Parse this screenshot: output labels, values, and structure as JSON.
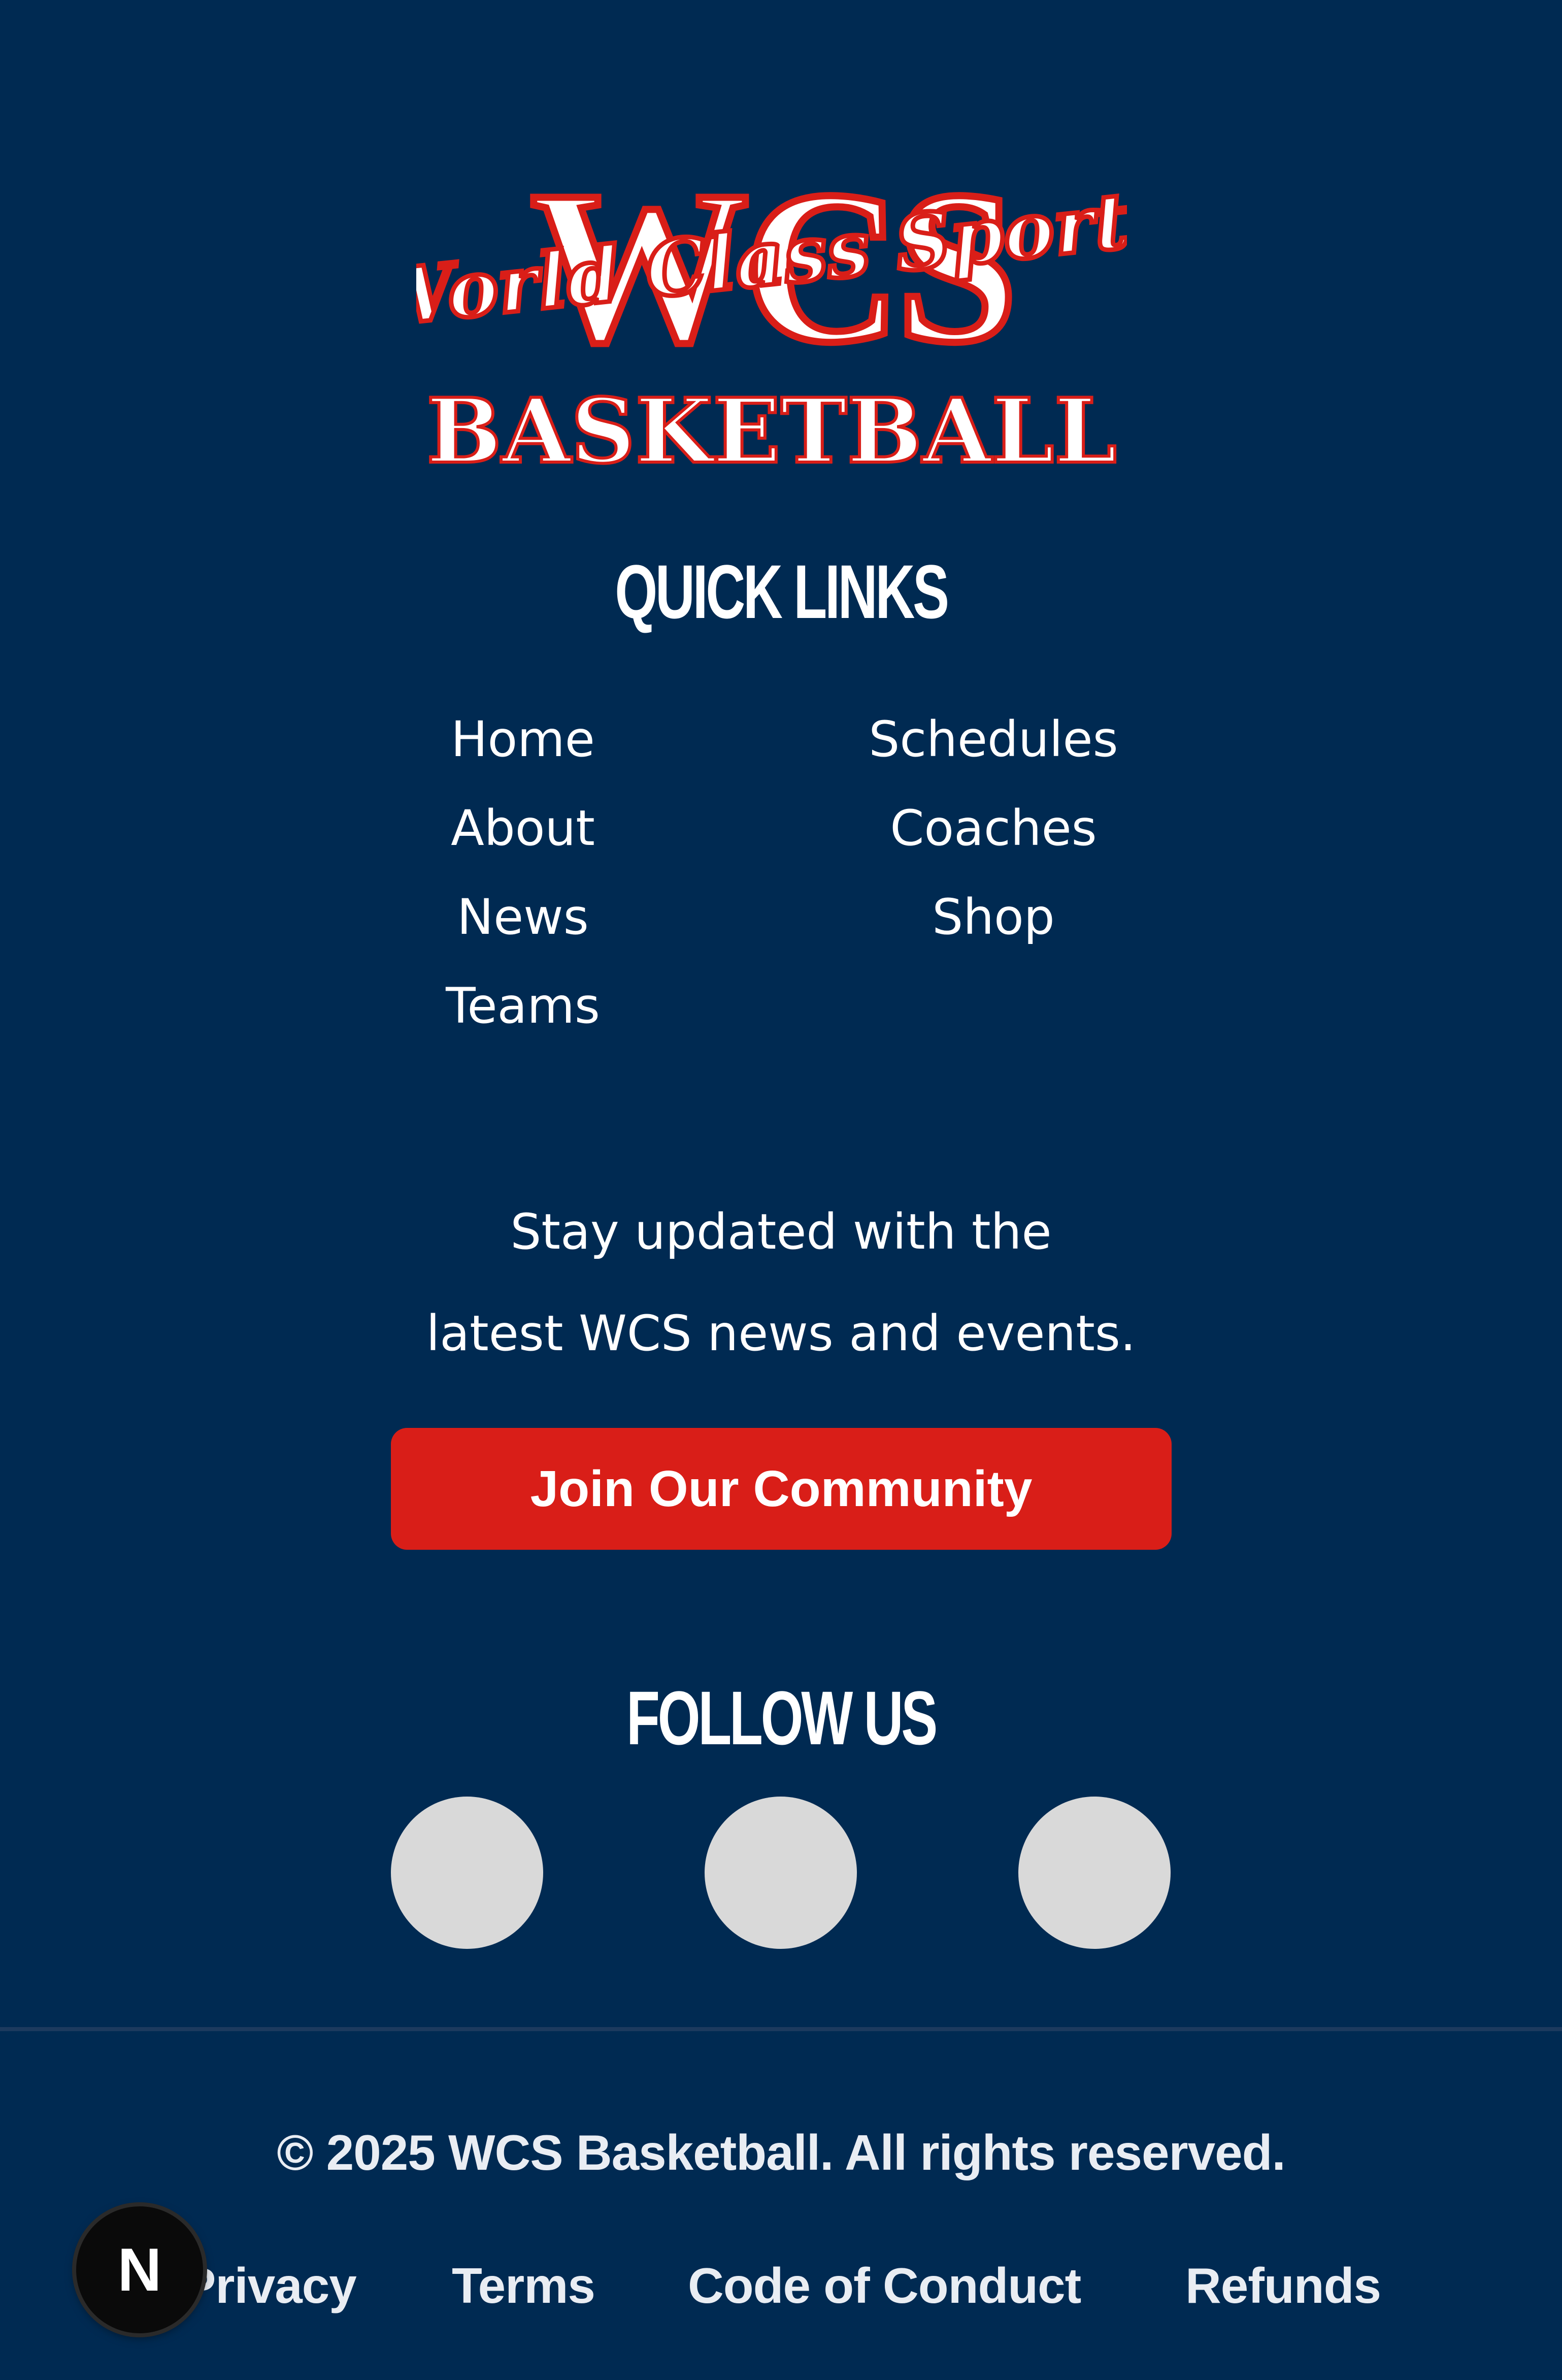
{
  "logo": {
    "mark": "WCS",
    "script": "World Class Sports",
    "wordmark": "BASKETBALL",
    "colors": {
      "fill": "#ffffff",
      "outline": "#d91e18"
    }
  },
  "quick_links": {
    "heading": "QUICK LINKS",
    "left": [
      "Home",
      "About",
      "News",
      "Teams"
    ],
    "right": [
      "Schedules",
      "Coaches",
      "Shop"
    ]
  },
  "newsletter": {
    "line1": "Stay updated with the",
    "line2": "latest WCS news and events.",
    "button_label": "Join Our Community",
    "button_color": "#d91e18"
  },
  "follow": {
    "heading": "FOLLOW US",
    "icons": [
      "social-icon",
      "social-icon",
      "social-icon"
    ]
  },
  "bottom": {
    "copyright": "© 2025 WCS Basketball. All rights reserved.",
    "links": [
      "Privacy",
      "Terms",
      "Code of Conduct",
      "Refunds"
    ]
  },
  "dev_badge": {
    "letter": "N"
  },
  "colors": {
    "background": "#002a52",
    "accent": "#d91e18",
    "placeholder": "#d9d9d9"
  }
}
